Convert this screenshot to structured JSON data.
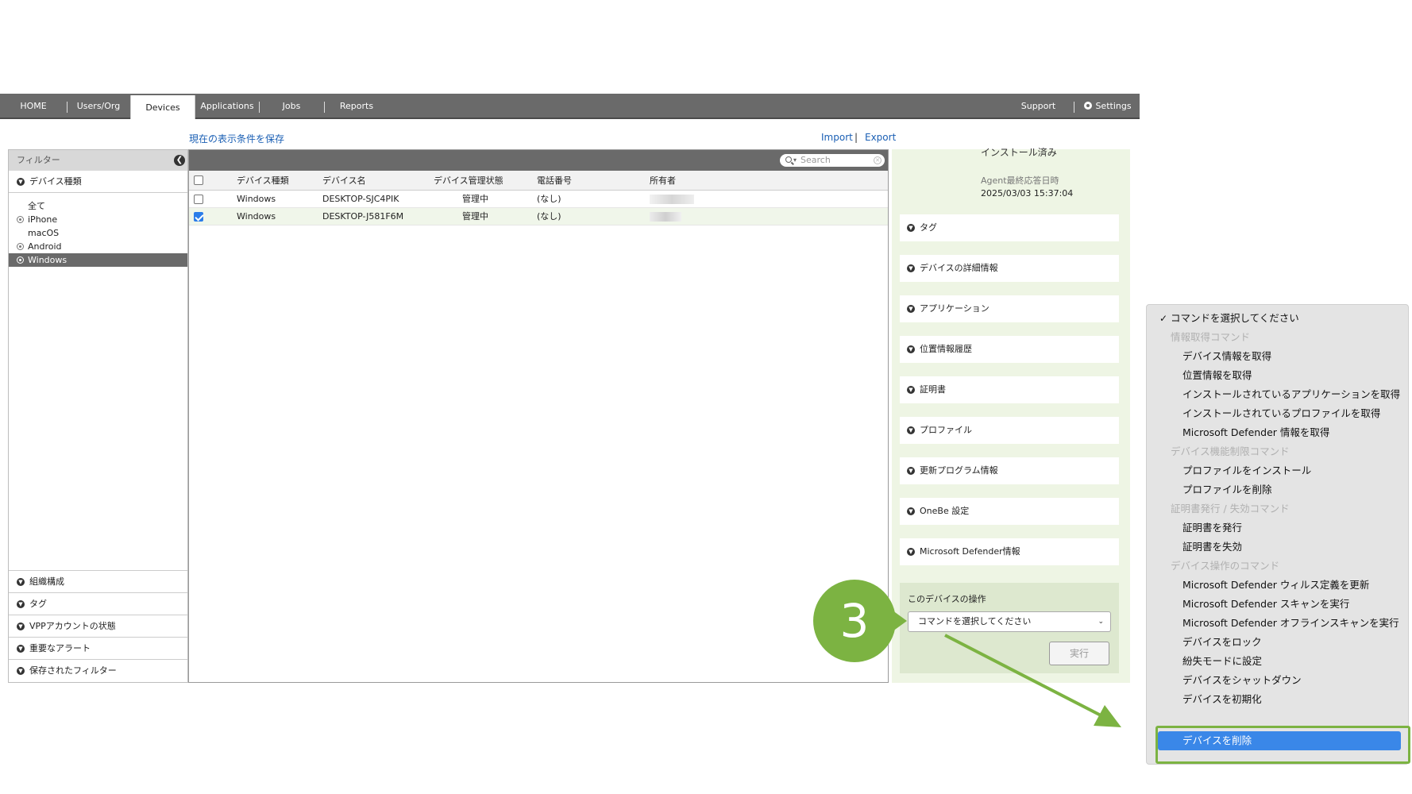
{
  "nav": {
    "tabs": [
      "HOME",
      "Users/Org",
      "Devices",
      "Applications",
      "Jobs",
      "Reports"
    ],
    "support": "Support",
    "settings": "Settings"
  },
  "toolbar": {
    "save_view": "現在の表示条件を保存",
    "import": "Import",
    "export": "Export",
    "search_placeholder": "Search"
  },
  "filter": {
    "title": "フィルター",
    "device_type_label": "デバイス種類",
    "types": [
      "全て",
      "iPhone",
      "macOS",
      "Android",
      "Windows"
    ],
    "selected_type": "Windows",
    "sections": [
      "組織構成",
      "タグ",
      "VPPアカウントの状態",
      "重要なアラート",
      "保存されたフィルター"
    ]
  },
  "table": {
    "columns": [
      "デバイス種類",
      "デバイス名",
      "デバイス管理状態",
      "電話番号",
      "所有者"
    ],
    "rows": [
      {
        "type": "Windows",
        "name": "DESKTOP-SJC4PIK",
        "status": "管理中",
        "phone": "(なし)",
        "checked": false
      },
      {
        "type": "Windows",
        "name": "DESKTOP-J581F6M",
        "status": "管理中",
        "phone": "(なし)",
        "checked": true
      }
    ]
  },
  "detail": {
    "install_status": "インストール済み",
    "agent_label": "Agent最終応答日時",
    "agent_value": "2025/03/03 15:37:04",
    "sections": [
      "タグ",
      "デバイスの詳細情報",
      "アプリケーション",
      "位置情報履歴",
      "証明書",
      "プロファイル",
      "更新プログラム情報",
      "OneBe 設定",
      "Microsoft Defender情報"
    ],
    "operation_title": "このデバイスの操作",
    "select_value": "コマンドを選択してください",
    "run_button": "実行"
  },
  "step_number": "3",
  "menu": {
    "items": [
      {
        "label": "コマンドを選択してください",
        "kind": "checked"
      },
      {
        "label": "情報取得コマンド",
        "kind": "group"
      },
      {
        "label": "デバイス情報を取得",
        "kind": "item"
      },
      {
        "label": "位置情報を取得",
        "kind": "item"
      },
      {
        "label": "インストールされているアプリケーションを取得",
        "kind": "item"
      },
      {
        "label": "インストールされているプロファイルを取得",
        "kind": "item"
      },
      {
        "label": "Microsoft Defender 情報を取得",
        "kind": "item"
      },
      {
        "label": "デバイス機能制限コマンド",
        "kind": "group"
      },
      {
        "label": "プロファイルをインストール",
        "kind": "item"
      },
      {
        "label": "プロファイルを削除",
        "kind": "item"
      },
      {
        "label": "証明書発行 / 失効コマンド",
        "kind": "group"
      },
      {
        "label": "証明書を発行",
        "kind": "item"
      },
      {
        "label": "証明書を失効",
        "kind": "item"
      },
      {
        "label": "デバイス操作のコマンド",
        "kind": "group"
      },
      {
        "label": "Microsoft Defender ウィルス定義を更新",
        "kind": "item"
      },
      {
        "label": "Microsoft Defender スキャンを実行",
        "kind": "item"
      },
      {
        "label": "Microsoft Defender オフラインスキャンを実行",
        "kind": "item"
      },
      {
        "label": "デバイスをロック",
        "kind": "item"
      },
      {
        "label": "紛失モードに設定",
        "kind": "item"
      },
      {
        "label": "デバイスをシャットダウン",
        "kind": "item"
      },
      {
        "label": "デバイスを初期化",
        "kind": "item"
      },
      {
        "label": "デバイスを削除",
        "kind": "highlighted"
      }
    ]
  },
  "colors": {
    "accent_green": "#7cb342",
    "nav_gray": "#6a6a6a",
    "link_blue": "#1a5fb4",
    "highlight_blue": "#3a87e8"
  }
}
